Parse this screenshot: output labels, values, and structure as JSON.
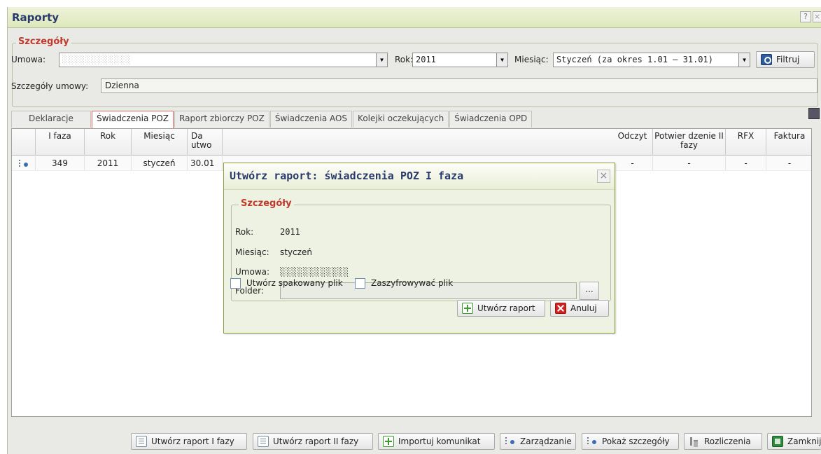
{
  "window": {
    "title": "Raporty",
    "help": "?",
    "close": "×"
  },
  "details": {
    "legend": "Szczegóły",
    "umowa_label": "Umowa:",
    "umowa_value": "░░░░░░░░░░░░",
    "rok_label": "Rok:",
    "rok_value": "2011",
    "miesiac_label": "Miesiąc:",
    "miesiac_value": "Styczeń (za okres 1.01 – 31.01)",
    "filter_label": "Filtruj",
    "szczegoly_umowy_label": "Szczegóły umowy:",
    "szczegoly_umowy_value": "Dzienna"
  },
  "tabs": [
    "Deklaracje",
    "Świadczenia POZ",
    "Raport zbiorczy POZ",
    "Świadczenia AOS",
    "Kolejki oczekujących",
    "Świadczenia OPD"
  ],
  "grid": {
    "headers": {
      "ifaza": "I faza",
      "rok": "Rok",
      "miesiac": "Miesiąc",
      "data": "Da utwo",
      "odczyt": "Odczyt",
      "potwierdzenie": "Potwier dzenie II fazy",
      "rfx": "RFX",
      "faktura": "Faktura"
    },
    "row": {
      "ifaza": "349",
      "rok": "2011",
      "miesiac": "styczeń",
      "data": "30.01",
      "odczyt": "-",
      "potwierdzenie": "-",
      "rfx": "-",
      "faktura": "-"
    }
  },
  "dialog": {
    "title": "Utwórz raport: świadczenia POZ I faza",
    "legend": "Szczegóły",
    "rok_label": "Rok:",
    "rok_value": "2011",
    "miesiac_label": "Miesiąc:",
    "miesiac_value": "styczeń",
    "umowa_label": "Umowa:",
    "umowa_value": "░░░░░░░░░░░░",
    "folder_label": "Folder:",
    "folder_value": "",
    "browse": "...",
    "zip_label": "Utwórz spakowany plik",
    "encrypt_label": "Zaszyfrowywać plik",
    "create_label": "Utwórz raport",
    "cancel_label": "Anuluj"
  },
  "toolbar": {
    "raport1": "Utwórz raport I fazy",
    "raport2": "Utwórz raport II fazy",
    "importuj": "Importuj komunikat",
    "zarzadzanie": "Zarządzanie",
    "pokaz": "Pokaż szczegóły",
    "rozliczenia": "Rozliczenia",
    "zamknij": "Zamknij"
  },
  "colors": {
    "accent": "#c0392b",
    "dialog_border": "#8aa23e",
    "title": "#2a3a6a"
  }
}
